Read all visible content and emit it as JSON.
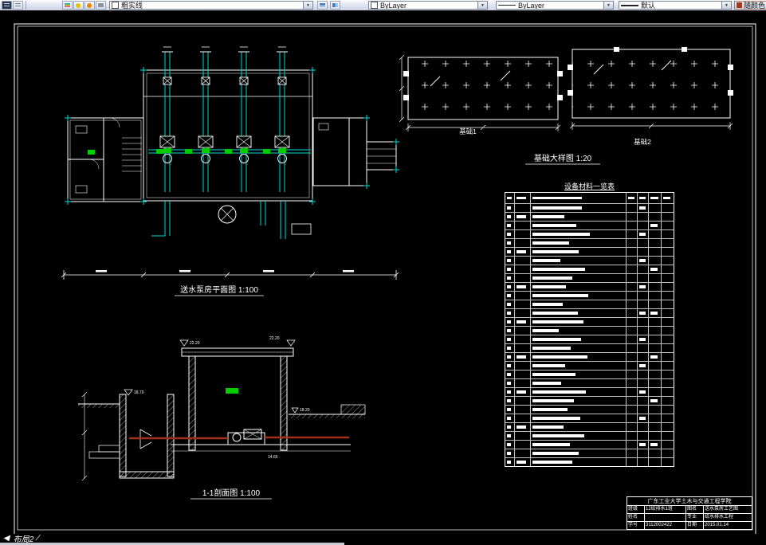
{
  "toolbar": {
    "layer_combo": {
      "value": "粗实线"
    },
    "color_combo": {
      "value": "ByLayer"
    },
    "linetype_combo": {
      "value": "ByLayer"
    },
    "lineweight_combo": {
      "value": "默认"
    },
    "color_mode_button": "随颜色"
  },
  "icons": {
    "dropdown_arrow": "▼",
    "tabs_scroll_left": "◀",
    "tab_slash": "∕"
  },
  "drawing_labels": {
    "floor_plan": "送水泵房平面图 1:100",
    "foundation1": "基础1",
    "foundation2": "基础2",
    "foundation_detail": "基础大样图 1:20",
    "section": "1-1剖面图 1:100",
    "level_tank": "18.70",
    "level_roof_left": "22.20",
    "level_roof_right": "22.20",
    "level_ground_right": "18.20",
    "level_floor": "14.65"
  },
  "equipment_table": {
    "title": "设备材料一览表",
    "header_bars": [
      6,
      12,
      62,
      8,
      8,
      10,
      9
    ],
    "rows": [
      62,
      40,
      55,
      72,
      46,
      58,
      35,
      66,
      50,
      42,
      70,
      38,
      57,
      64,
      33,
      61,
      48,
      69,
      41,
      54,
      36,
      67,
      52,
      44,
      60,
      39,
      65,
      47,
      58,
      50
    ]
  },
  "title_block": {
    "school": "广东工业大学土木与交通工程学院",
    "rows": [
      [
        "班级",
        "12给排水1班",
        "图名",
        "送水泵房工艺图"
      ],
      [
        "姓名",
        "",
        "专业",
        "给水排水工程"
      ],
      [
        "学号",
        "3112002422",
        "日期",
        "2015.01.14"
      ]
    ]
  },
  "status": {
    "layout_tab": "布局2"
  },
  "colors": {
    "pipe": "#00DADA",
    "valve": "#00CC00",
    "red_pipe": "#A03019",
    "line": "#FFFFFF"
  }
}
